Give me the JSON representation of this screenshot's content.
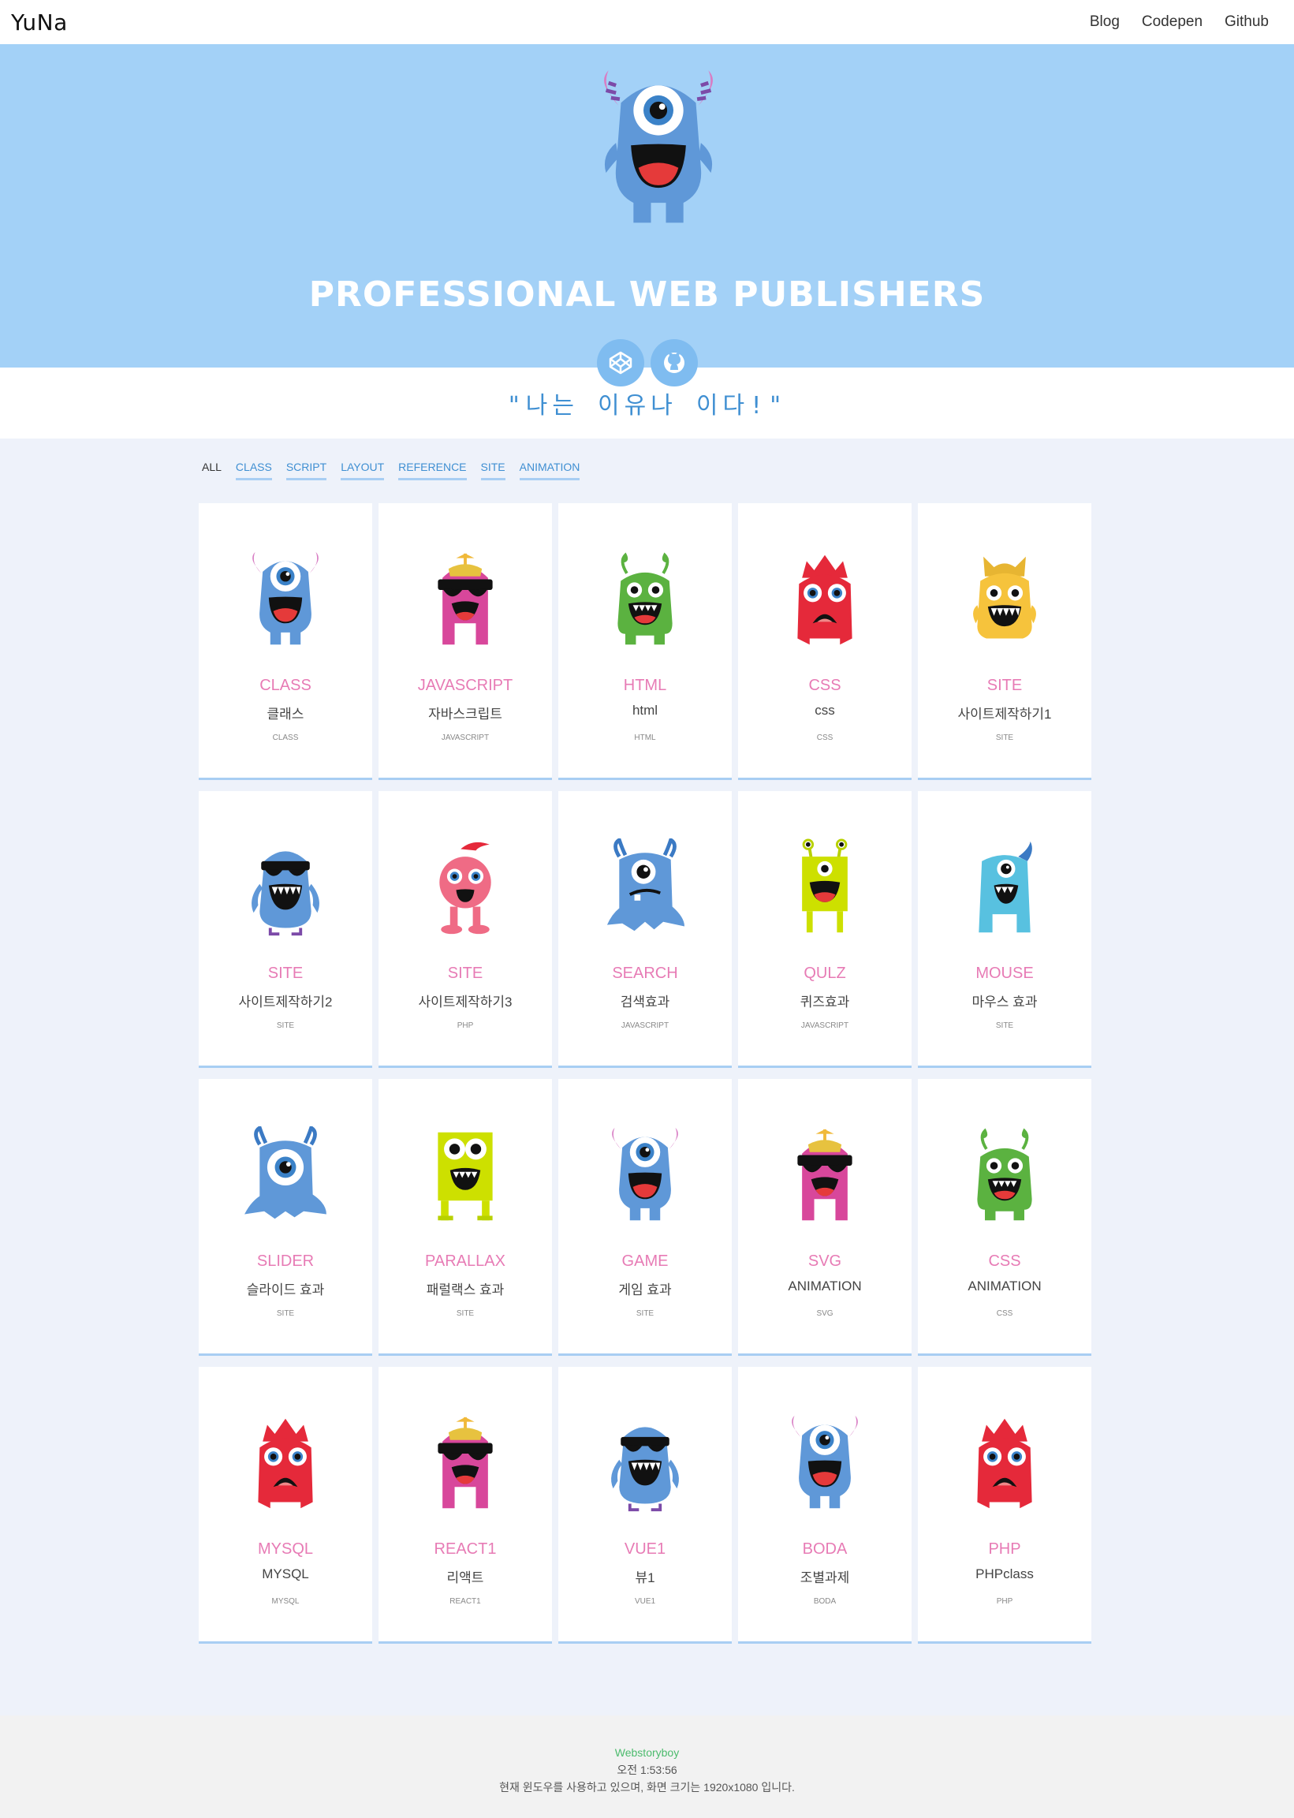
{
  "header": {
    "logo": "YuNa",
    "nav": [
      "Blog",
      "Codepen",
      "Github"
    ]
  },
  "hero": {
    "title": "PROFESSIONAL WEB PUBLISHERS",
    "icons": [
      "codepen-icon",
      "github-icon"
    ]
  },
  "quote": "\"나는 이유나 이다!\"",
  "filters": [
    "ALL",
    "CLASS",
    "SCRIPT",
    "LAYOUT",
    "REFERENCE",
    "SITE",
    "ANIMATION"
  ],
  "cards": [
    {
      "title": "CLASS",
      "subtitle": "클래스",
      "tag": "CLASS",
      "monster": "blue-horns"
    },
    {
      "title": "JAVASCRIPT",
      "subtitle": "자바스크립트",
      "tag": "JAVASCRIPT",
      "monster": "pink-shades"
    },
    {
      "title": "HTML",
      "subtitle": "html",
      "tag": "HTML",
      "monster": "green"
    },
    {
      "title": "CSS",
      "subtitle": "css",
      "tag": "CSS",
      "monster": "red"
    },
    {
      "title": "SITE",
      "subtitle": "사이트제작하기1",
      "tag": "SITE",
      "monster": "yellow"
    },
    {
      "title": "SITE",
      "subtitle": "사이트제작하기2",
      "tag": "SITE",
      "monster": "blue-shades"
    },
    {
      "title": "SITE",
      "subtitle": "사이트제작하기3",
      "tag": "PHP",
      "monster": "pink-round"
    },
    {
      "title": "SEARCH",
      "subtitle": "검색효과",
      "tag": "JAVASCRIPT",
      "monster": "blue-squid"
    },
    {
      "title": "QULZ",
      "subtitle": "퀴즈효과",
      "tag": "JAVASCRIPT",
      "monster": "lime-tall"
    },
    {
      "title": "MOUSE",
      "subtitle": "마우스 효과",
      "tag": "SITE",
      "monster": "cyan"
    },
    {
      "title": "SLIDER",
      "subtitle": "슬라이드 효과",
      "tag": "SITE",
      "monster": "blue-blob"
    },
    {
      "title": "PARALLAX",
      "subtitle": "패럴랙스 효과",
      "tag": "SITE",
      "monster": "lime-square"
    },
    {
      "title": "GAME",
      "subtitle": "게임 효과",
      "tag": "SITE",
      "monster": "blue-horns"
    },
    {
      "title": "SVG",
      "subtitle": "ANIMATION",
      "tag": "SVG",
      "monster": "pink-shades"
    },
    {
      "title": "CSS",
      "subtitle": "ANIMATION",
      "tag": "CSS",
      "monster": "green"
    },
    {
      "title": "MYSQL",
      "subtitle": "MYSQL",
      "tag": "MYSQL",
      "monster": "red"
    },
    {
      "title": "REACT1",
      "subtitle": "리액트",
      "tag": "REACT1",
      "monster": "pink-shades"
    },
    {
      "title": "VUE1",
      "subtitle": "뷰1",
      "tag": "VUE1",
      "monster": "blue-shades"
    },
    {
      "title": "BODA",
      "subtitle": "조별과제",
      "tag": "BODA",
      "monster": "blue-horns"
    },
    {
      "title": "PHP",
      "subtitle": "PHPclass",
      "tag": "PHP",
      "monster": "red"
    }
  ],
  "footer": {
    "brand": "Webstoryboy",
    "time": "오전 1:53:56",
    "message": "현재 윈도우를 사용하고 있으며, 화면 크기는 1920x1080 입니다."
  }
}
